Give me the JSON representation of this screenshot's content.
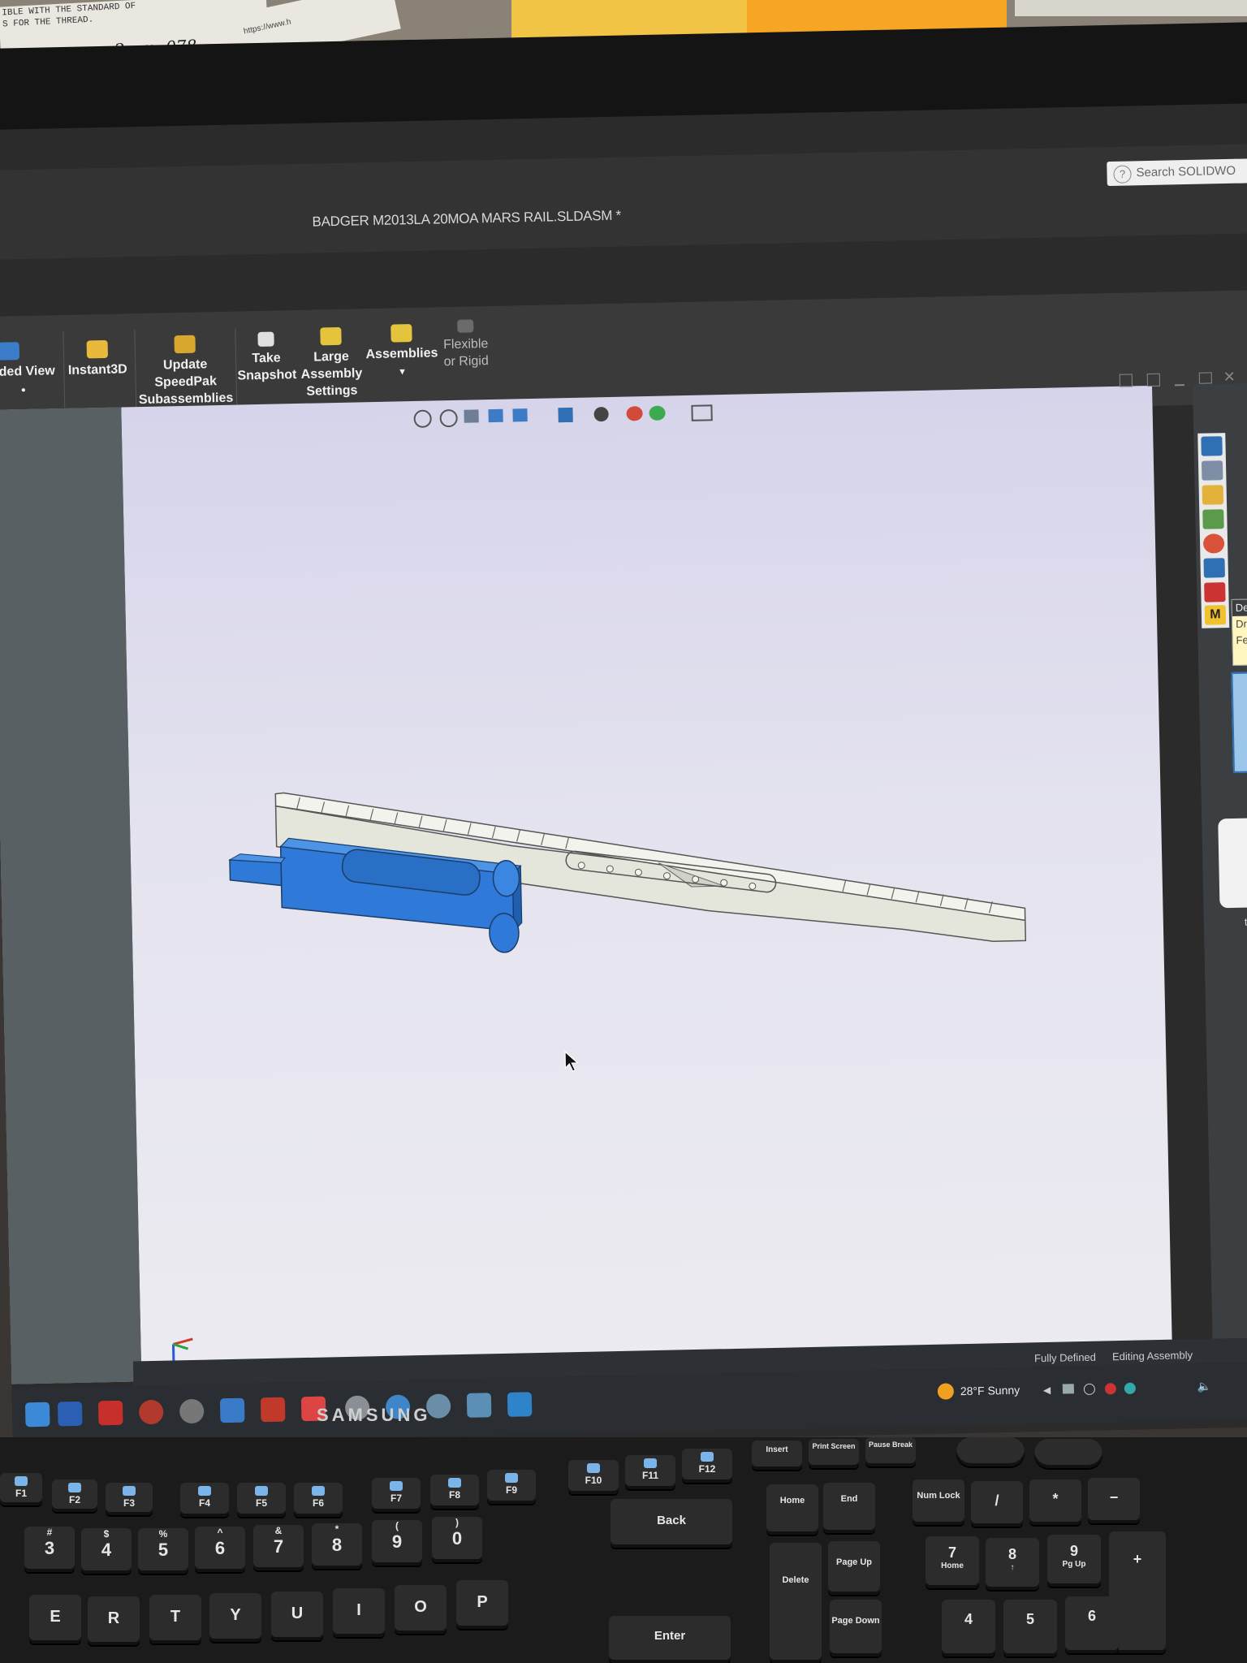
{
  "window": {
    "title": "BADGER M2013LA 20MOA MARS RAIL.SLDASM *",
    "search_placeholder": "Search SOLIDWO"
  },
  "ribbon": {
    "buttons": [
      {
        "label": "oded View"
      },
      {
        "label": "Instant3D"
      },
      {
        "label": "Update SpeedPak Subassemblies"
      },
      {
        "label": "Take Snapshot"
      },
      {
        "label": "Large Assembly Settings"
      },
      {
        "label": "Assemblies"
      },
      {
        "label": "Flexible or Rigid"
      }
    ]
  },
  "taskpane": {
    "tooltip_lines": [
      "De",
      "Dra",
      "Feat"
    ],
    "partial_text": "te",
    "m_badge": "M"
  },
  "statusbar": {
    "left": "Fully Defined",
    "right": "Editing Assembly"
  },
  "taskbar": {
    "weather": "28°F  Sunny"
  },
  "monitor_brand": "SAMSUNG",
  "desk_notes": {
    "line1": "IBLE WITH THE STANDARD OF",
    "line2": "S FOR THE THREAD.",
    "handwriting": "2mm  .078",
    "url": "https://www.h"
  },
  "keyboard": {
    "fkeys": [
      "F1",
      "F2",
      "F3",
      "F4",
      "F5",
      "F6",
      "F7",
      "F8",
      "F9",
      "F10",
      "F11",
      "F12"
    ],
    "nav_keys": [
      "Insert",
      "Print Screen",
      "Pause Break",
      "Home",
      "End",
      "Delete",
      "Page Up",
      "Page Down"
    ],
    "numpad": [
      "Num Lock",
      "/",
      "*",
      "−",
      "7",
      "8",
      "9",
      "+",
      "4",
      "5",
      "6"
    ],
    "numpad_sub": [
      "Home",
      "↑",
      "Pg Up"
    ],
    "number_row": [
      "3",
      "4",
      "5",
      "6",
      "7",
      "8",
      "9",
      "0"
    ],
    "number_row_shift": [
      "#",
      "$",
      "%",
      "^",
      "&",
      "*",
      "(",
      ")"
    ],
    "letter_row": [
      "E",
      "R",
      "T",
      "Y",
      "U",
      "I",
      "O",
      "P"
    ],
    "back_label": "Back",
    "enter_label": "Enter"
  }
}
